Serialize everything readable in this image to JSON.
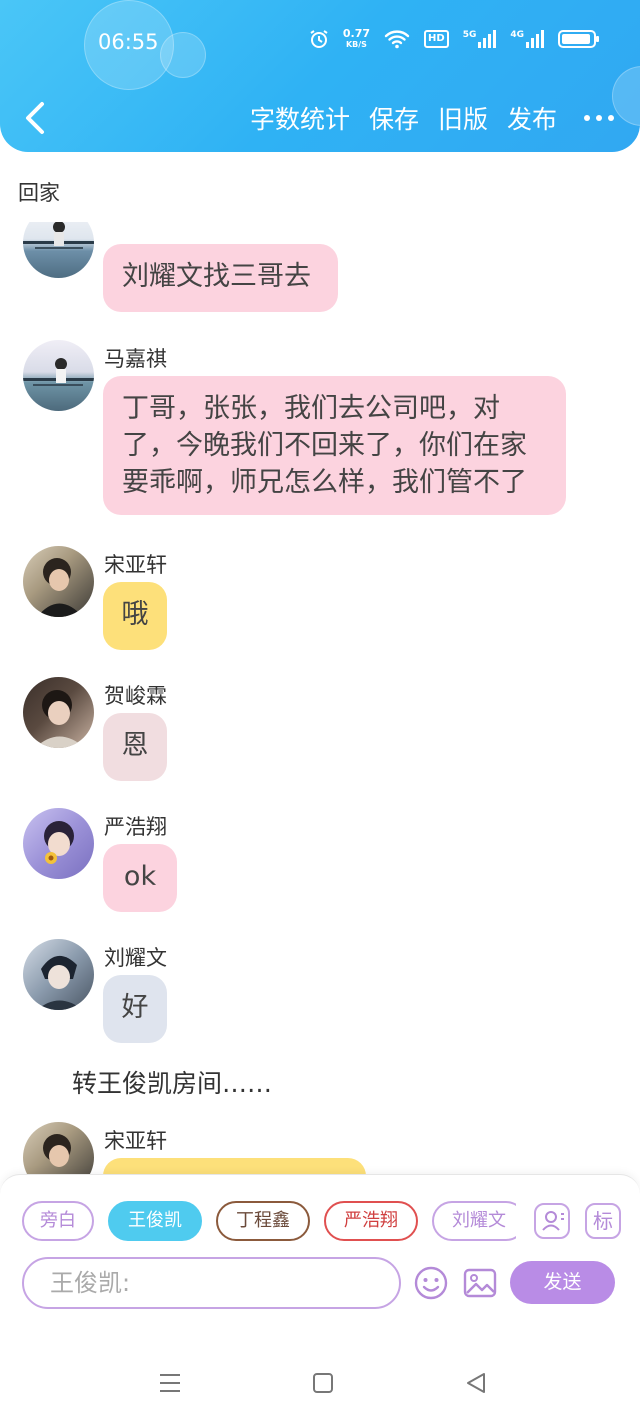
{
  "status_bar": {
    "time": "06:55",
    "net_speed_value": "0.77",
    "net_speed_unit": "KB/S",
    "hd_label": "HD",
    "sig1_label": "5G",
    "sig2_label": "4G"
  },
  "header": {
    "actions": [
      "字数统计",
      "保存",
      "旧版",
      "发布"
    ]
  },
  "room": {
    "title": "回家"
  },
  "colors": {
    "accent": "#3db8f5",
    "pink_bubble": "#fcd3df",
    "yellow_bubble": "#fde07a",
    "gray_pink_bubble": "#f1dde0",
    "gray_blue_bubble": "#dfe4ee",
    "send": "#b98ce6",
    "chip_active": "#4fcbef"
  },
  "messages": [
    {
      "name": "",
      "text": "刘耀文找三哥去"
    },
    {
      "name": "马嘉祺",
      "text": "丁哥，张张，我们去公司吧，对了，今晚我们不回来了，你们在家要乖啊，师兄怎么样，我们管不了"
    },
    {
      "name": "宋亚轩",
      "text": "哦"
    },
    {
      "name": "贺峻霖",
      "text": "恩"
    },
    {
      "name": "严浩翔",
      "text": "ok"
    },
    {
      "name": "刘耀文",
      "text": "好"
    },
    {
      "name": "宋亚轩",
      "text": ""
    }
  ],
  "narration": {
    "text": "转王俊凯房间……"
  },
  "composer": {
    "chips": [
      "旁白",
      "王俊凯",
      "丁程鑫",
      "严浩翔",
      "刘耀文"
    ],
    "tag_label": "标",
    "input_placeholder": "王俊凯:",
    "send_label": "发送"
  }
}
